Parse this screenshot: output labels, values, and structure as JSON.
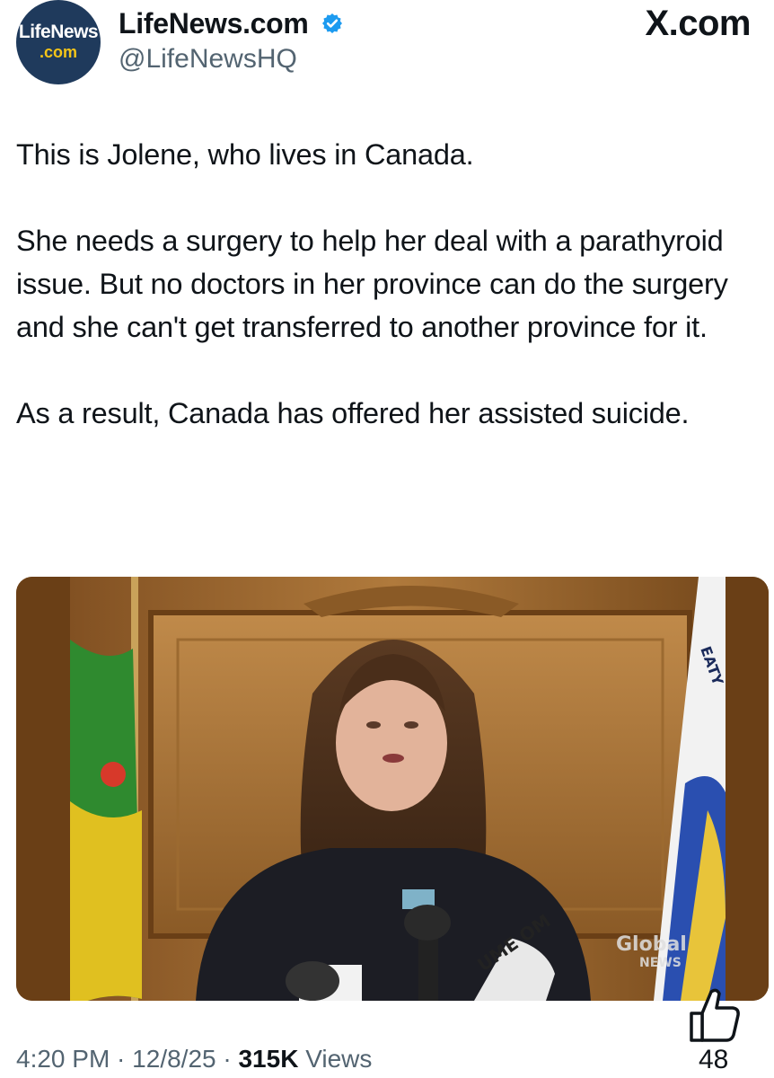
{
  "header": {
    "avatar_line1": "LifeNews",
    "avatar_line2": ".com",
    "display_name": "LifeNews.com",
    "handle": "@LifeNewsHQ",
    "source_label": "X.com"
  },
  "tweet": {
    "text": "This is Jolene, who lives in Canada.\n\nShe needs a surgery to help her deal with a parathyroid issue. But no doctors in her province can do the surgery and she can't get transferred to another province for it.\n\nAs a result, Canada has offered her assisted suicide."
  },
  "media": {
    "watermark_line1": "Global",
    "watermark_line2": "NEWS",
    "flag_text": "EATY",
    "mic_text": "UME OM"
  },
  "footer": {
    "time": "4:20 PM",
    "separator": " · ",
    "date": "12/8/25",
    "views_count": "315K",
    "views_label": " Views",
    "like_count": "48"
  },
  "colors": {
    "verified": "#1d9bf0",
    "secondary_text": "#536471",
    "avatar_bg": "#1f3a5c",
    "avatar_accent": "#f5c518"
  }
}
